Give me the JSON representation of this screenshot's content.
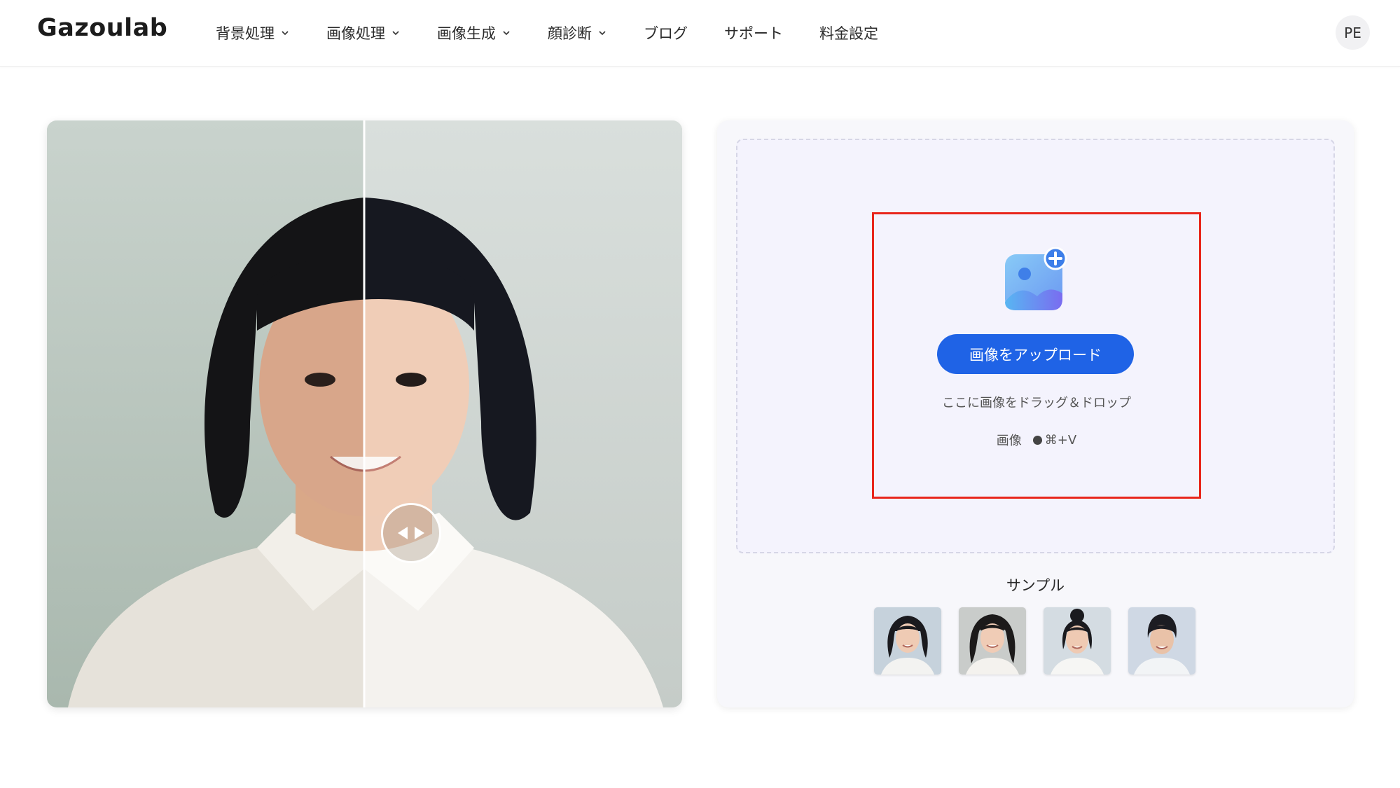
{
  "header": {
    "logo": "Gazoulab",
    "nav": [
      {
        "label": "背景処理",
        "dropdown": true
      },
      {
        "label": "画像処理",
        "dropdown": true
      },
      {
        "label": "画像生成",
        "dropdown": true
      },
      {
        "label": "顔診断",
        "dropdown": true
      },
      {
        "label": "ブログ",
        "dropdown": false
      },
      {
        "label": "サポート",
        "dropdown": false
      },
      {
        "label": "料金設定",
        "dropdown": false
      }
    ],
    "avatar_initials": "PE"
  },
  "compare": {
    "slider_position": 0.5,
    "handle_icon": "left-right-arrows-icon"
  },
  "upload": {
    "icon": "image-add-icon",
    "button_label": "画像をアップロード",
    "drag_text": "ここに画像をドラッグ＆ドロップ",
    "paste_label": "画像",
    "paste_shortcut": "⌘+V"
  },
  "samples": {
    "title": "サンプル",
    "items": [
      "sample-1",
      "sample-2",
      "sample-3",
      "sample-4"
    ]
  },
  "colors": {
    "accent": "#1f63e6",
    "highlight_border": "#e8261c",
    "dropzone_bg": "#f4f3fd"
  }
}
